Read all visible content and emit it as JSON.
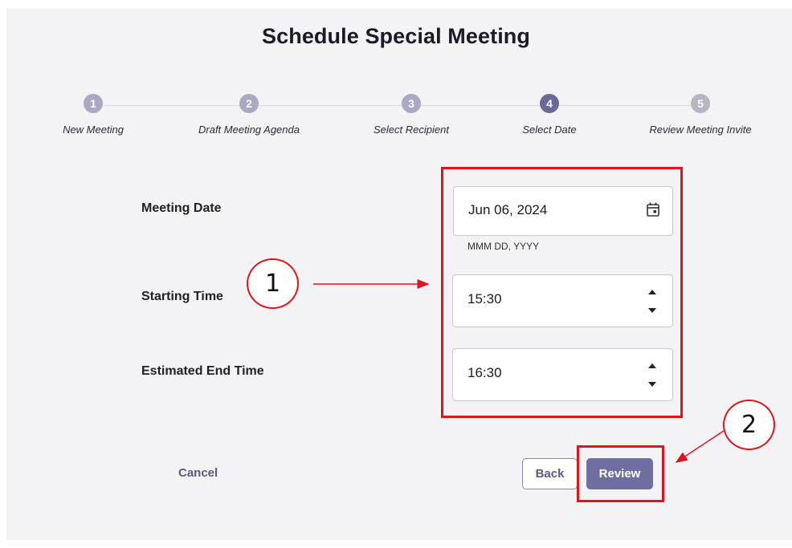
{
  "title": "Schedule Special Meeting",
  "steps": [
    {
      "num": "1",
      "label": "New Meeting"
    },
    {
      "num": "2",
      "label": "Draft Meeting Agenda"
    },
    {
      "num": "3",
      "label": "Select Recipient"
    },
    {
      "num": "4",
      "label": "Select Date"
    },
    {
      "num": "5",
      "label": "Review Meeting Invite"
    }
  ],
  "active_step": "4",
  "form": {
    "date_label": "Meeting Date",
    "date_value": "Jun 06, 2024",
    "date_helper": "MMM DD, YYYY",
    "start_label": "Starting Time",
    "start_value": "15:30",
    "end_label": "Estimated End Time",
    "end_value": "16:30"
  },
  "actions": {
    "cancel": "Cancel",
    "back": "Back",
    "review": "Review"
  },
  "annotations": {
    "callout_1": "1",
    "callout_2": "2"
  },
  "icons": {
    "date_picker": "calendar-icon",
    "stepper": "spinner-arrows-icon"
  },
  "colors": {
    "active_step": "#6a6a98",
    "completed_step": "#a9a9c4",
    "primary_button": "#6e6ea0",
    "annotation": "#e2141b"
  }
}
